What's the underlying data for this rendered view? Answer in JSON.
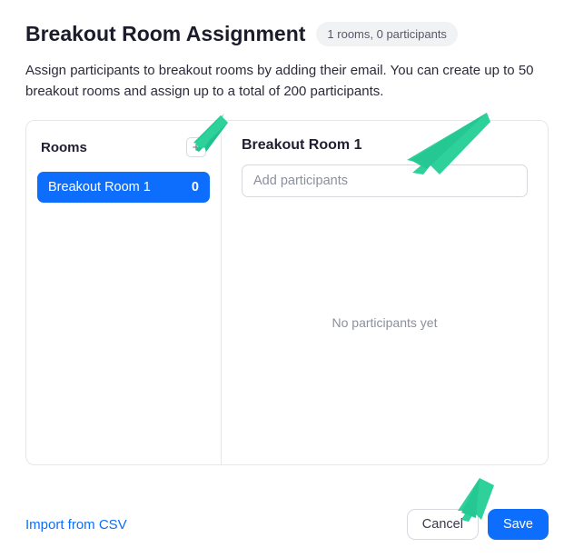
{
  "header": {
    "title": "Breakout Room Assignment",
    "badge": "1 rooms, 0 participants"
  },
  "description": "Assign participants to breakout rooms by adding their email. You can create up to 50 breakout rooms and assign up to a total of 200 participants.",
  "sidebar": {
    "heading": "Rooms",
    "add_label": "+",
    "items": [
      {
        "name": "Breakout Room 1",
        "count": "0"
      }
    ]
  },
  "main": {
    "room_title": "Breakout Room 1",
    "add_placeholder": "Add participants",
    "empty_text": "No participants yet"
  },
  "footer": {
    "import_label": "Import from CSV",
    "cancel_label": "Cancel",
    "save_label": "Save"
  },
  "colors": {
    "accent": "#0d6efd",
    "arrow": "#2fd19a"
  }
}
